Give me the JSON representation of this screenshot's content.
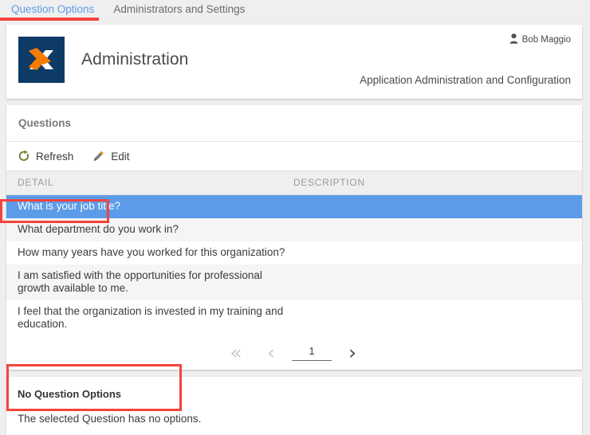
{
  "tabs": [
    {
      "label": "Question Options",
      "active": true
    },
    {
      "label": "Administrators and Settings",
      "active": false
    }
  ],
  "header": {
    "app_title": "Administration",
    "user_name": "Bob Maggio",
    "user_icon": "person-icon",
    "subtitle": "Application Administration and Configuration",
    "logo_icon": "x-logo-icon",
    "logo_bg": "#0d3b66",
    "logo_orange": "#f57c00",
    "logo_white": "#ffffff"
  },
  "questions_panel": {
    "title": "Questions",
    "toolbar": {
      "refresh_label": "Refresh",
      "refresh_icon": "refresh-icon",
      "edit_label": "Edit",
      "edit_icon": "pencil-icon"
    },
    "columns": [
      {
        "key": "detail",
        "label": "DETAIL"
      },
      {
        "key": "description",
        "label": "DESCRIPTION"
      }
    ],
    "rows": [
      {
        "detail": "What is your job title?",
        "description": "",
        "selected": true
      },
      {
        "detail": "What department do you work in?",
        "description": "",
        "selected": false
      },
      {
        "detail": "How many years have you worked for this organization?",
        "description": "",
        "selected": false
      },
      {
        "detail": "I am satisfied with the opportunities for professional growth available to me.",
        "description": "",
        "selected": false
      },
      {
        "detail": "I feel that the organization is invested in my training and education.",
        "description": "",
        "selected": false
      }
    ],
    "pagination": {
      "first_icon": "«",
      "prev_icon": "‹",
      "page_value": "1",
      "next_icon": "›"
    }
  },
  "options_panel": {
    "title": "No Question Options",
    "message": "The selected Question has no options."
  },
  "colors": {
    "accent_red": "#f4443c",
    "tab_active": "#5c9ce6",
    "row_selected": "#5b9be8",
    "page_bg": "#efeff0"
  }
}
